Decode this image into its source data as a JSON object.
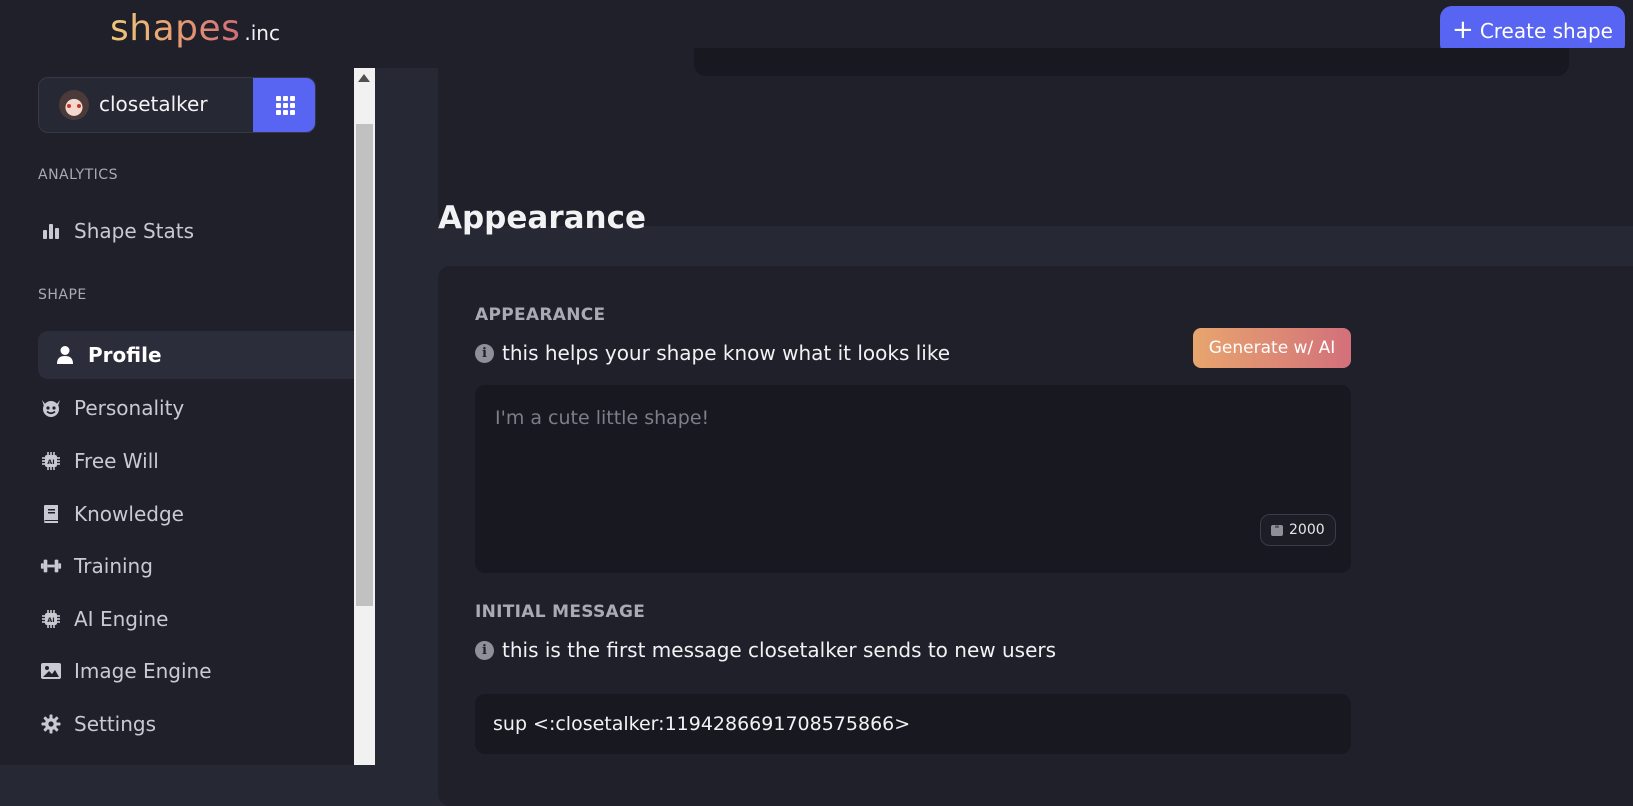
{
  "header": {
    "logo_main": "shapes",
    "logo_suffix": ".inc",
    "create_button_label": "Create shape"
  },
  "user": {
    "name": "closetalker"
  },
  "sidebar": {
    "analytics_label": "ANALYTICS",
    "analytics_items": [
      {
        "label": "Shape Stats",
        "icon": "bar-chart-icon"
      }
    ],
    "shape_label": "SHAPE",
    "shape_items": [
      {
        "label": "Profile",
        "icon": "user-icon",
        "active": true
      },
      {
        "label": "Personality",
        "icon": "devil-face-icon"
      },
      {
        "label": "Free Will",
        "icon": "ai-chip-icon"
      },
      {
        "label": "Knowledge",
        "icon": "book-icon"
      },
      {
        "label": "Training",
        "icon": "dumbbell-icon"
      },
      {
        "label": "AI Engine",
        "icon": "ai-chip-icon"
      },
      {
        "label": "Image Engine",
        "icon": "image-icon"
      },
      {
        "label": "Settings",
        "icon": "gear-icon"
      }
    ]
  },
  "main": {
    "section_title": "Appearance",
    "appearance": {
      "label": "APPEARANCE",
      "hint": "this helps your shape know what it looks like",
      "generate_button": "Generate w/ AI",
      "placeholder": "I'm a cute little shape!",
      "char_count": "2000"
    },
    "initial_message": {
      "label": "INITIAL MESSAGE",
      "hint": "this is the first message closetalker sends to new users",
      "value": "sup <:closetalker:1194286691708575866>"
    }
  },
  "colors": {
    "accent": "#5865f2",
    "sidebar_bg": "#1f2029",
    "content_bg": "#262834",
    "gradient_start": "#e7a56e",
    "gradient_end": "#d3707b"
  }
}
